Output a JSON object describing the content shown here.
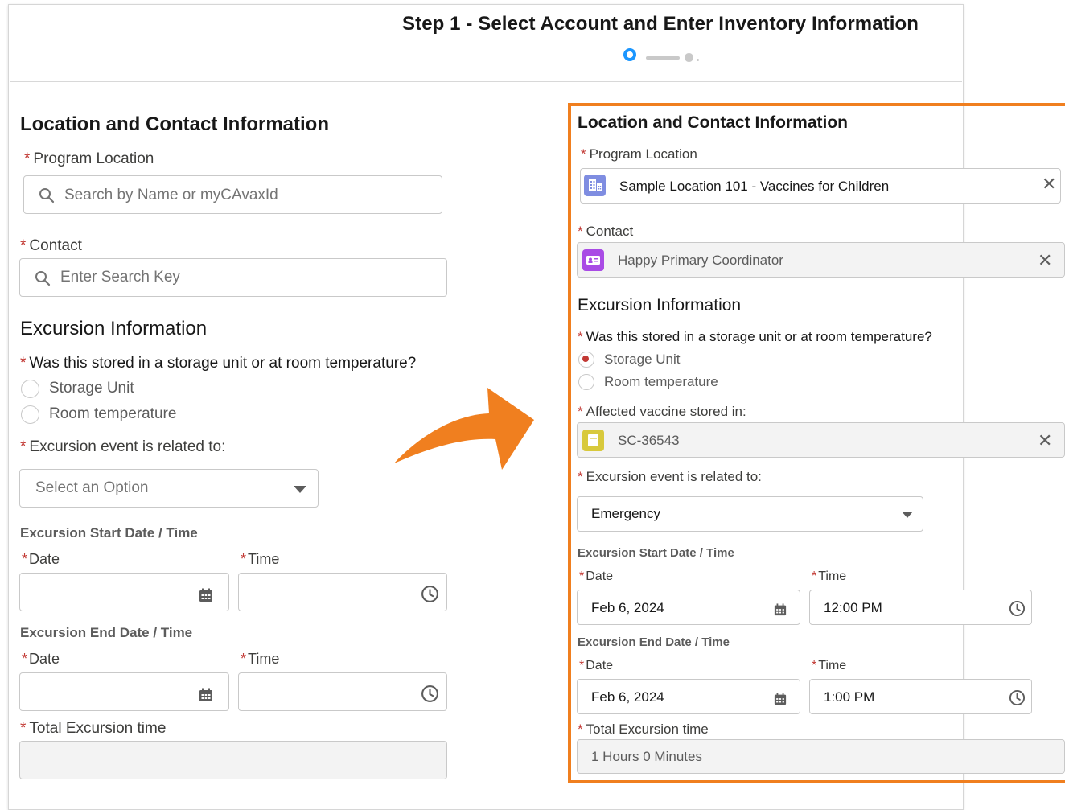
{
  "step": {
    "title": "Step 1 - Select Account and Enter Inventory Information"
  },
  "left": {
    "section_title": "Location and Contact Information",
    "program_location": {
      "label": "Program Location",
      "placeholder": "Search by Name or myCAvaxId"
    },
    "contact": {
      "label": "Contact",
      "placeholder": "Enter Search Key"
    },
    "excursion_title": "Excursion Information",
    "stored_question": "Was this stored in a storage unit or at room temperature?",
    "radio_storage": "Storage Unit",
    "radio_room": "Room temperature",
    "event_label": "Excursion event is related to:",
    "event_placeholder": "Select an Option",
    "start_head": "Excursion Start Date / Time",
    "end_head": "Excursion End Date / Time",
    "date_label": "Date",
    "time_label": "Time",
    "total_label": "Total Excursion time"
  },
  "right": {
    "section_title": "Location and Contact Information",
    "program_location": {
      "label": "Program Location",
      "value": "Sample Location 101 - Vaccines for Children"
    },
    "contact": {
      "label": "Contact",
      "value": "Happy Primary Coordinator"
    },
    "excursion_title": "Excursion Information",
    "stored_question": "Was this stored in a storage unit or at room temperature?",
    "radio_storage": "Storage Unit",
    "radio_room": "Room temperature",
    "affected_label": "Affected vaccine stored in:",
    "affected_value": "SC-36543",
    "event_label": "Excursion event is related to:",
    "event_value": "Emergency",
    "start_head": "Excursion Start Date / Time",
    "end_head": "Excursion End Date / Time",
    "date_label": "Date",
    "time_label": "Time",
    "start_date": "Feb 6, 2024",
    "start_time": "12:00 PM",
    "end_date": "Feb 6, 2024",
    "end_time": "1:00 PM",
    "total_label": "Total Excursion time",
    "total_value": "1 Hours 0 Minutes"
  },
  "icons": {
    "location": "building-icon",
    "contact": "contact-card-icon",
    "storage": "storage-unit-icon",
    "accent_blue": "#1b96ff",
    "location_color": "#7f8de1",
    "contact_color": "#a94be5",
    "storage_color": "#d8c93c",
    "highlight": "#f07f1f",
    "required": "#c23934"
  }
}
